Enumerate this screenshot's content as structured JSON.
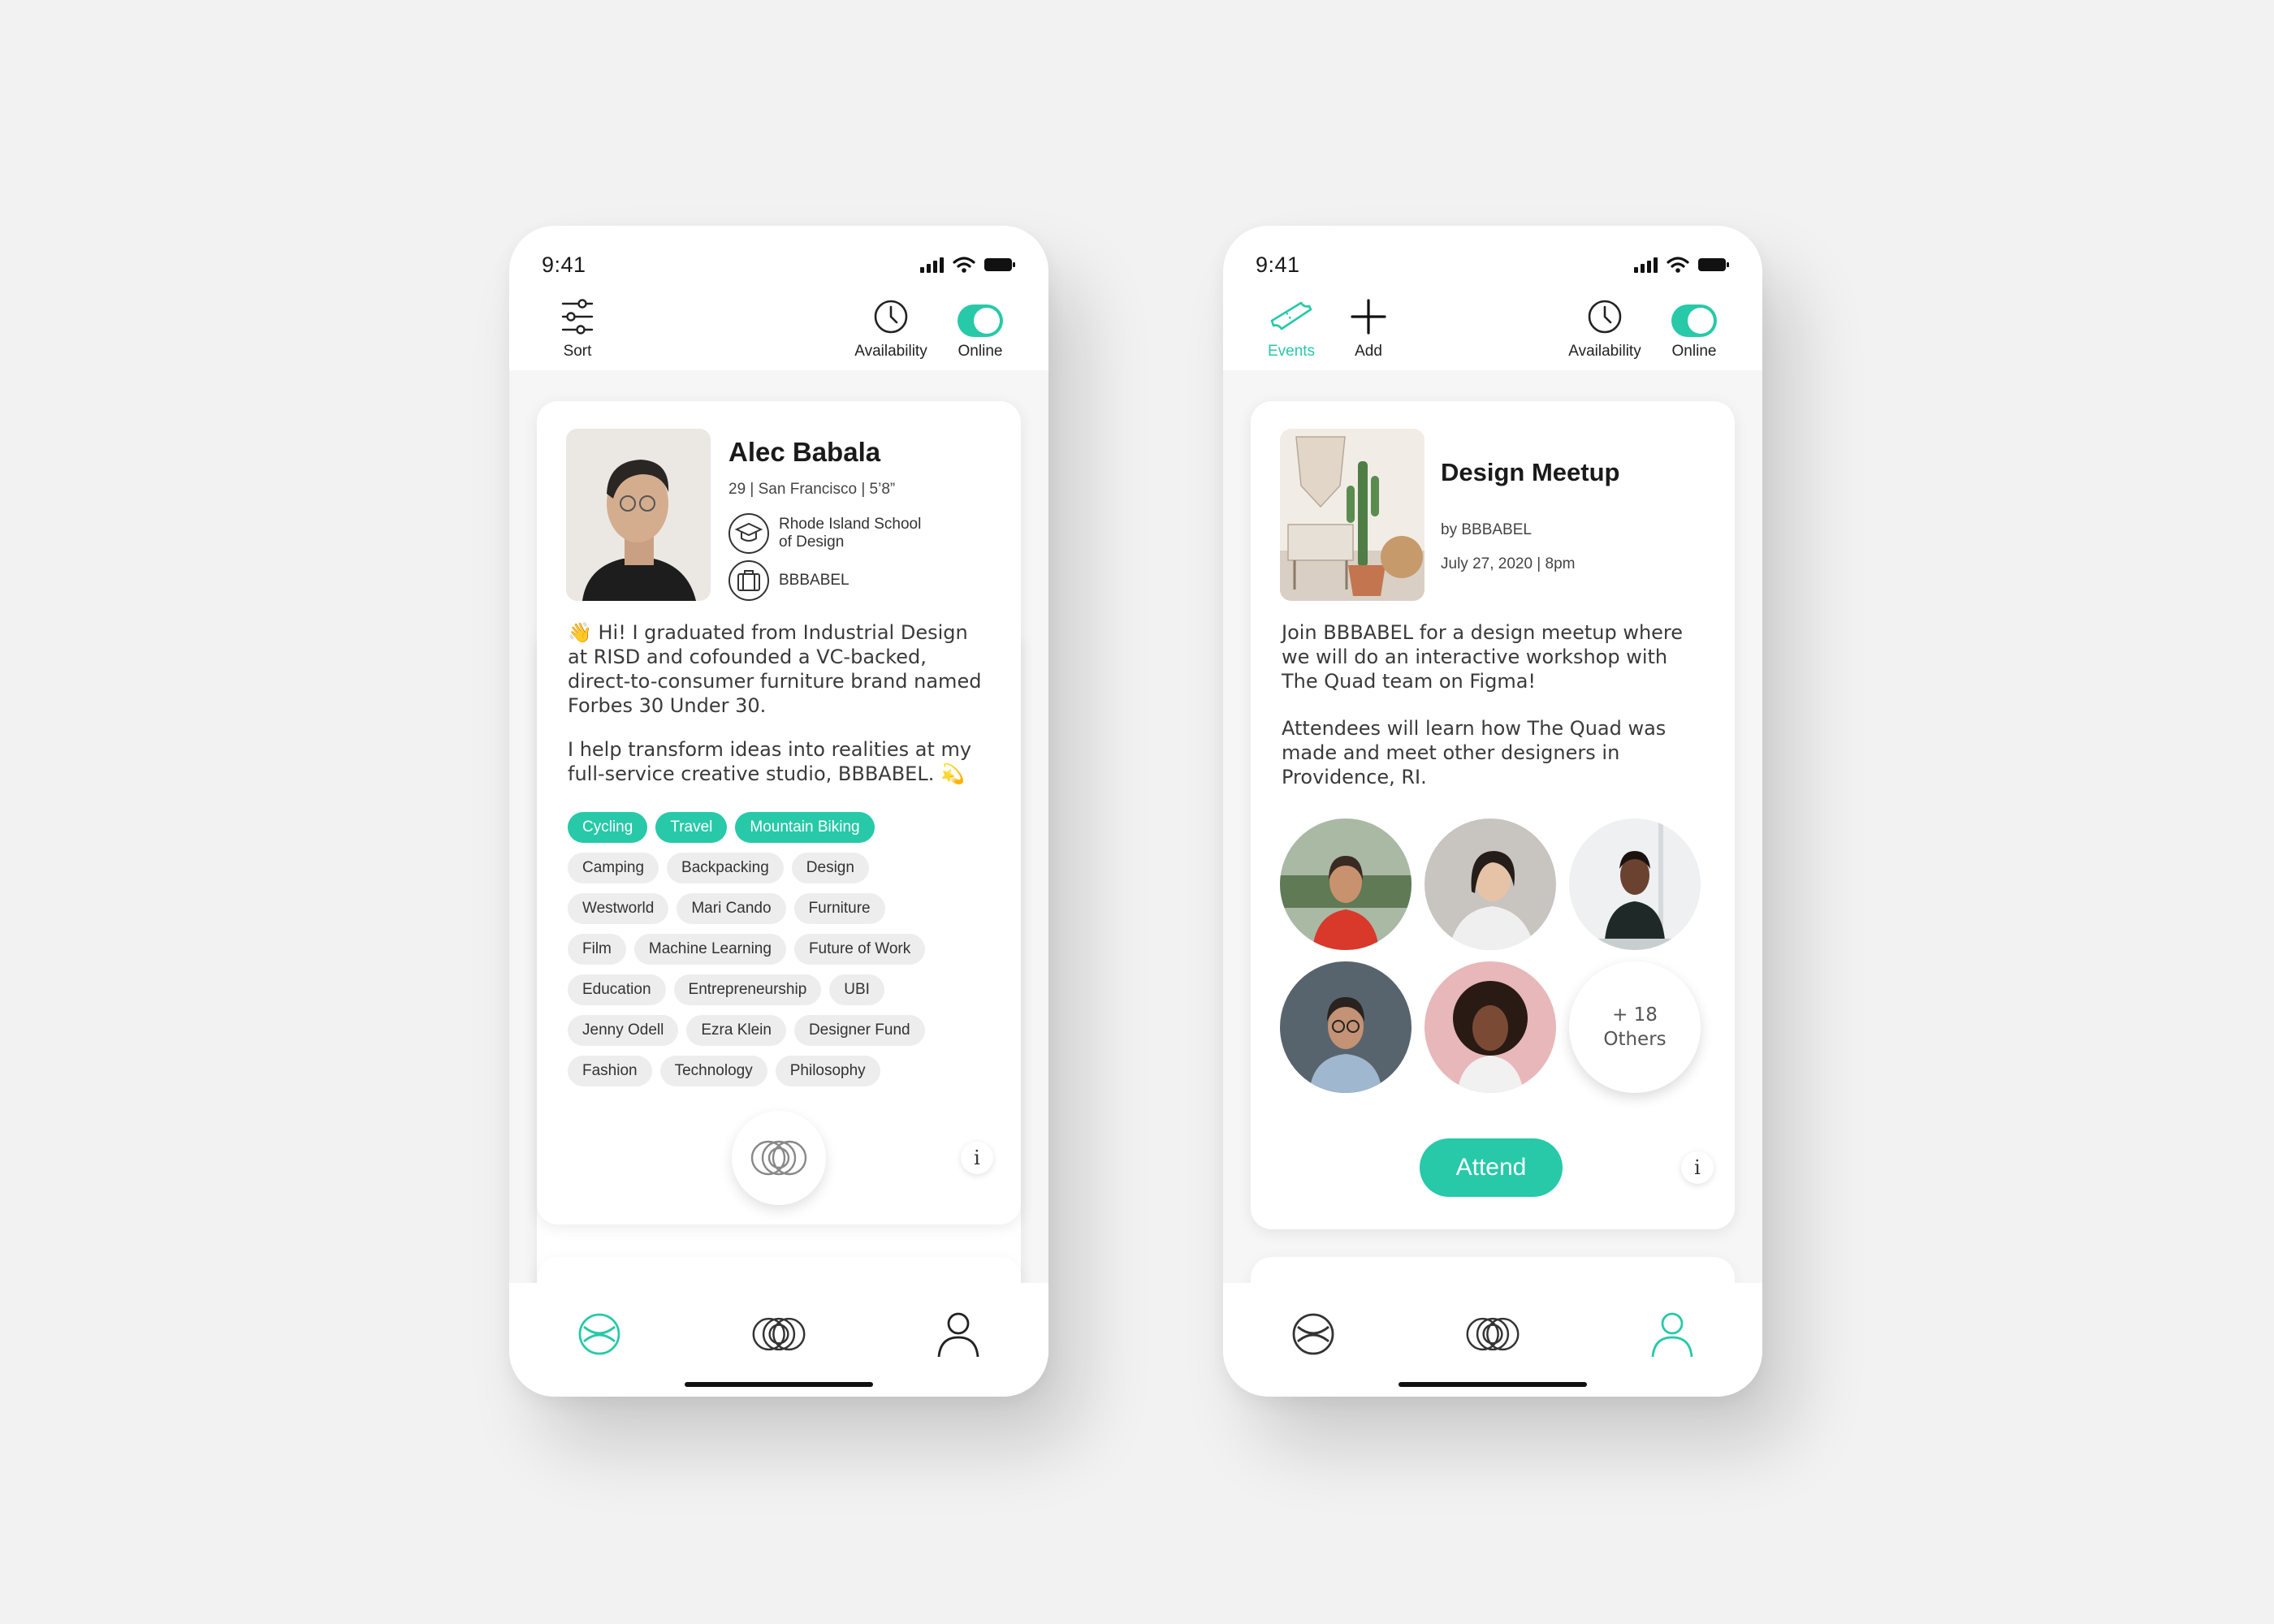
{
  "profile_screen": {
    "status": {
      "time": "9:41"
    },
    "toolbar": {
      "sort_label": "Sort",
      "availability_label": "Availability",
      "online_label": "Online"
    },
    "card": {
      "name": "Alec Babala",
      "meta": "29 | San Francisco | 5’8”",
      "school": "Rhode Island School of Design",
      "school_line1": "Rhode Island School",
      "school_line2": "of Design",
      "work": "BBBABEL",
      "bio_p1": "👋 Hi! I graduated from Industrial Design at RISD and cofounded a VC-backed, direct-to-consumer furniture brand named Forbes 30 Under 30.",
      "bio_p2": "I help transform ideas into realities at my full-service creative studio, BBBABEL. 💫",
      "tag_rows": [
        [
          {
            "label": "Cycling",
            "active": true
          },
          {
            "label": "Travel",
            "active": true
          },
          {
            "label": "Mountain Biking",
            "active": true
          }
        ],
        [
          {
            "label": "Camping"
          },
          {
            "label": "Backpacking"
          },
          {
            "label": "Design"
          }
        ],
        [
          {
            "label": "Westworld"
          },
          {
            "label": "Mari Cando"
          },
          {
            "label": "Furniture"
          }
        ],
        [
          {
            "label": "Film"
          },
          {
            "label": "Machine Learning"
          },
          {
            "label": "Future of Work"
          }
        ],
        [
          {
            "label": "Education"
          },
          {
            "label": "Entrepreneurship"
          },
          {
            "label": "UBI"
          }
        ],
        [
          {
            "label": "Jenny Odell"
          },
          {
            "label": "Ezra Klein"
          },
          {
            "label": "Designer Fund"
          }
        ],
        [
          {
            "label": "Fashion"
          },
          {
            "label": "Technology"
          },
          {
            "label": "Philosophy"
          }
        ]
      ],
      "info_label": "i"
    },
    "tabs": {
      "active": "discover"
    }
  },
  "event_screen": {
    "status": {
      "time": "9:41"
    },
    "toolbar": {
      "events_label": "Events",
      "add_label": "Add",
      "availability_label": "Availability",
      "online_label": "Online"
    },
    "card": {
      "title": "Design Meetup",
      "by": "by BBBABEL",
      "date": "July 27, 2020 | 8pm",
      "desc_p1": "Join BBBABEL for a design meetup where we will do an interactive workshop with The Quad team on Figma!",
      "desc_p2": "Attendees will learn how The Quad was made and meet other designers in Providence, RI.",
      "more_line1": "+ 18",
      "more_line2": "Others",
      "attend_label": "Attend",
      "info_label": "i"
    },
    "tabs": {
      "active": "profile"
    }
  },
  "colors": {
    "accent": "#27c9a8",
    "text": "#1a1a1a",
    "tag_bg": "#ededed",
    "background": "#f2f2f2"
  }
}
